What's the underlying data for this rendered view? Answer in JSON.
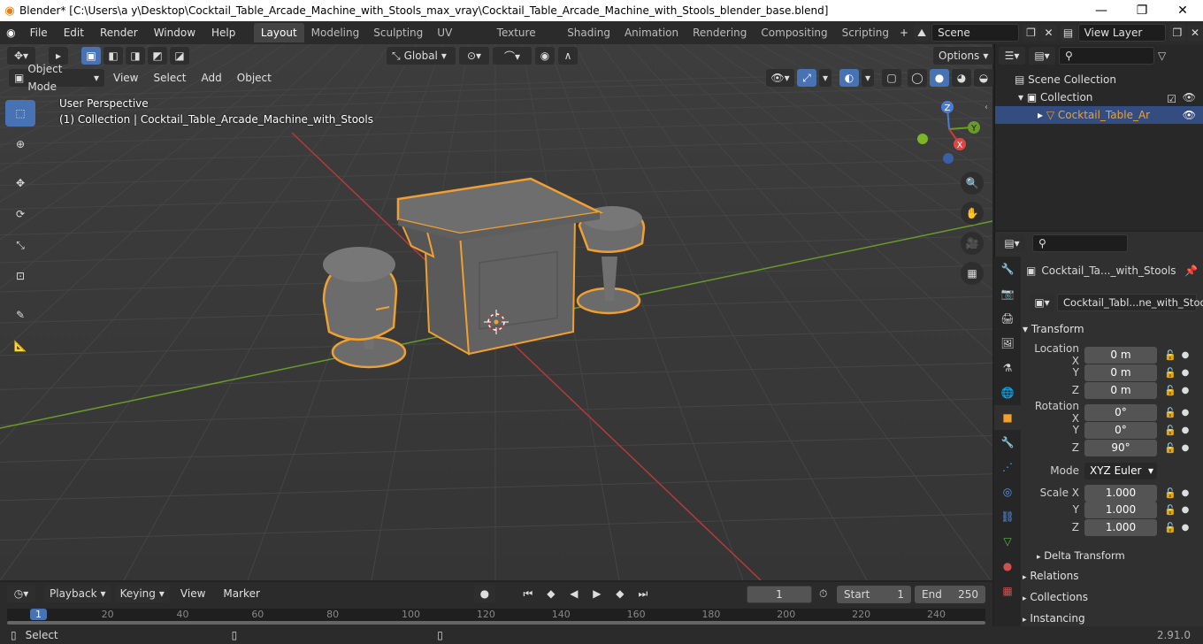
{
  "window": {
    "title": "Blender* [C:\\Users\\a y\\Desktop\\Cocktail_Table_Arcade_Machine_with_Stools_max_vray\\Cocktail_Table_Arcade_Machine_with_Stools_blender_base.blend]",
    "minimize": "—",
    "maximize": "❐",
    "close": "✕"
  },
  "menu": [
    "File",
    "Edit",
    "Render",
    "Window",
    "Help"
  ],
  "workspaces": [
    "Layout",
    "Modeling",
    "Sculpting",
    "UV Editing",
    "Texture Paint",
    "Shading",
    "Animation",
    "Rendering",
    "Compositing",
    "Scripting"
  ],
  "scene_name": "Scene",
  "view_layer": "View Layer",
  "header": {
    "transform_orientation": "Global",
    "options": "Options",
    "mode": "Object Mode",
    "view": "View",
    "select": "Select",
    "add": "Add",
    "object": "Object"
  },
  "viewport": {
    "perspective": "User Perspective",
    "collection_info": "(1) Collection | Cocktail_Table_Arcade_Machine_with_Stools",
    "gizmo": {
      "x": "X",
      "y": "Y",
      "z": "Z"
    }
  },
  "outliner": {
    "scene_collection": "Scene Collection",
    "collection": "Collection",
    "object": "Cocktail_Table_Arcade_Machine_with_Stools"
  },
  "properties": {
    "object_name": "Cocktail_Ta..._with_Stools",
    "data_name": "Cocktail_Tabl...ne_with_Stools",
    "transform": "Transform",
    "location": {
      "label": "Location X",
      "x": "0 m",
      "y": "0 m",
      "z": "0 m"
    },
    "rotation": {
      "label": "Rotation X",
      "x": "0°",
      "y": "0°",
      "z": "90°"
    },
    "mode_label": "Mode",
    "mode_value": "XYZ Euler",
    "scale": {
      "label": "Scale X",
      "x": "1.000",
      "y": "1.000",
      "z": "1.000"
    },
    "axis_y": "Y",
    "axis_z": "Z",
    "delta_transform": "Delta Transform",
    "relations": "Relations",
    "collections": "Collections",
    "instancing": "Instancing"
  },
  "timeline": {
    "playback": "Playback",
    "keying": "Keying",
    "view": "View",
    "marker": "Marker",
    "current_frame": "1",
    "start_label": "Start",
    "start": "1",
    "end_label": "End",
    "end": "250",
    "ticks": [
      "1",
      "20",
      "40",
      "60",
      "80",
      "100",
      "120",
      "140",
      "160",
      "180",
      "200",
      "220",
      "240"
    ]
  },
  "status": {
    "select": "Select",
    "version": "2.91.0"
  },
  "colors": {
    "accent": "#4772b3",
    "selection_outline": "#f0a030",
    "x_axis": "#b53a3a",
    "y_axis": "#6a9a2a"
  }
}
